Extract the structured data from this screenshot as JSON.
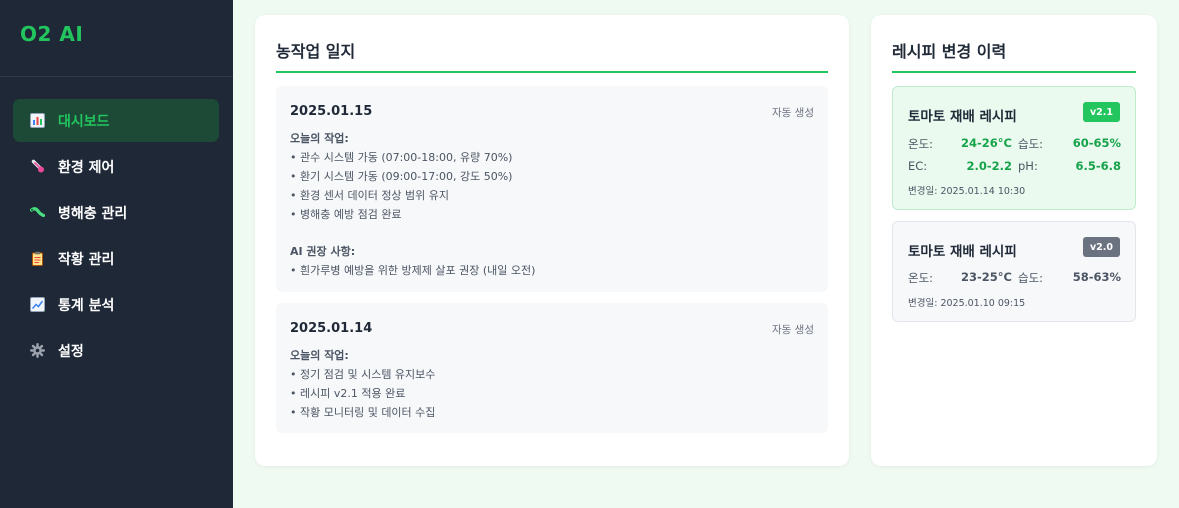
{
  "app": {
    "brand": "O2 AI"
  },
  "sidebar": {
    "items": [
      {
        "label": "대시보드",
        "icon": "bar-chart-icon",
        "active": true
      },
      {
        "label": "환경 제어",
        "icon": "thermometer-icon",
        "active": false
      },
      {
        "label": "병해충 관리",
        "icon": "bug-icon",
        "active": false
      },
      {
        "label": "작황 관리",
        "icon": "clipboard-icon",
        "active": false
      },
      {
        "label": "통계 분석",
        "icon": "trend-chart-icon",
        "active": false
      },
      {
        "label": "설정",
        "icon": "gear-icon",
        "active": false
      }
    ]
  },
  "log": {
    "title": "농작업 일지",
    "entries": [
      {
        "date": "2025.01.15",
        "auto_label": "자동 생성",
        "work_heading": "오늘의 작업:",
        "work_items": [
          "• 관수 시스템 가동 (07:00-18:00, 유량 70%)",
          "• 환기 시스템 가동 (09:00-17:00, 강도 50%)",
          "• 환경 센서 데이터 정상 범위 유지",
          "• 병해충 예방 점검 완료"
        ],
        "ai_heading": "AI 권장 사항:",
        "ai_items": [
          "• 흰가루병 예방을 위한 방제제 살포 권장 (내일 오전)"
        ]
      },
      {
        "date": "2025.01.14",
        "auto_label": "자동 생성",
        "work_heading": "오늘의 작업:",
        "work_items": [
          "• 정기 점검 및 시스템 유지보수",
          "• 레시피 v2.1 적용 완료",
          "• 작황 모니터링 및 데이터 수집"
        ]
      }
    ]
  },
  "recipes": {
    "title": "레시피 변경 이력",
    "accent": "#22c55e",
    "items": [
      {
        "name": "토마토 재배 레시피",
        "version": "v2.1",
        "badge_color": "#22c55e",
        "value_color": "#16a34a",
        "rows": [
          [
            {
              "label": "온도:",
              "value": "24-26°C"
            },
            {
              "label": "습도:",
              "value": "60-65%"
            }
          ],
          [
            {
              "label": "EC:",
              "value": "2.0-2.2"
            },
            {
              "label": "pH:",
              "value": "6.5-6.8"
            }
          ]
        ],
        "changed": "변경일: 2025.01.14 10:30"
      },
      {
        "name": "토마토 재배 레시피",
        "version": "v2.0",
        "badge_color": "#6b7280",
        "value_color": "#4b5563",
        "rows": [
          [
            {
              "label": "온도:",
              "value": "23-25°C"
            },
            {
              "label": "습도:",
              "value": "58-63%"
            }
          ]
        ],
        "changed": "변경일: 2025.01.10 09:15"
      }
    ]
  }
}
